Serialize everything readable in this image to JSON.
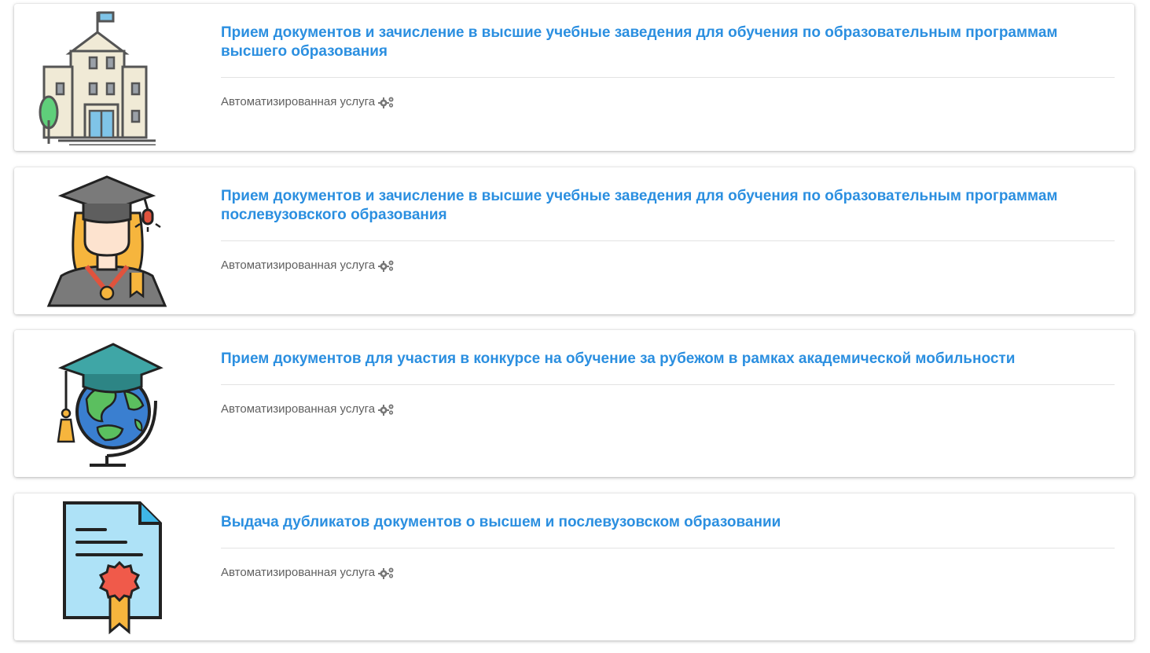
{
  "services": [
    {
      "title": "Прием документов и зачисление в высшие учебные заведения для обучения по образовательным программам высшего образования",
      "meta": "Автоматизированная услуга",
      "icon": "university-building-icon"
    },
    {
      "title": "Прием документов и зачисление в высшие учебные заведения для обучения по образовательным программам послевузовского образования",
      "meta": "Автоматизированная услуга",
      "icon": "graduate-student-icon"
    },
    {
      "title": "Прием документов для участия в конкурсе на обучение за рубежом в рамках академической мобильности",
      "meta": "Автоматизированная услуга",
      "icon": "globe-graduation-cap-icon"
    },
    {
      "title": "Выдача дубликатов документов о высшем и послевузовском образовании",
      "meta": "Автоматизированная услуга",
      "icon": "diploma-certificate-icon"
    }
  ],
  "meta_icon": "gears-icon",
  "colors": {
    "title_link": "#2b8fe0",
    "meta_text": "#606060",
    "divider": "#e3e3e3"
  }
}
